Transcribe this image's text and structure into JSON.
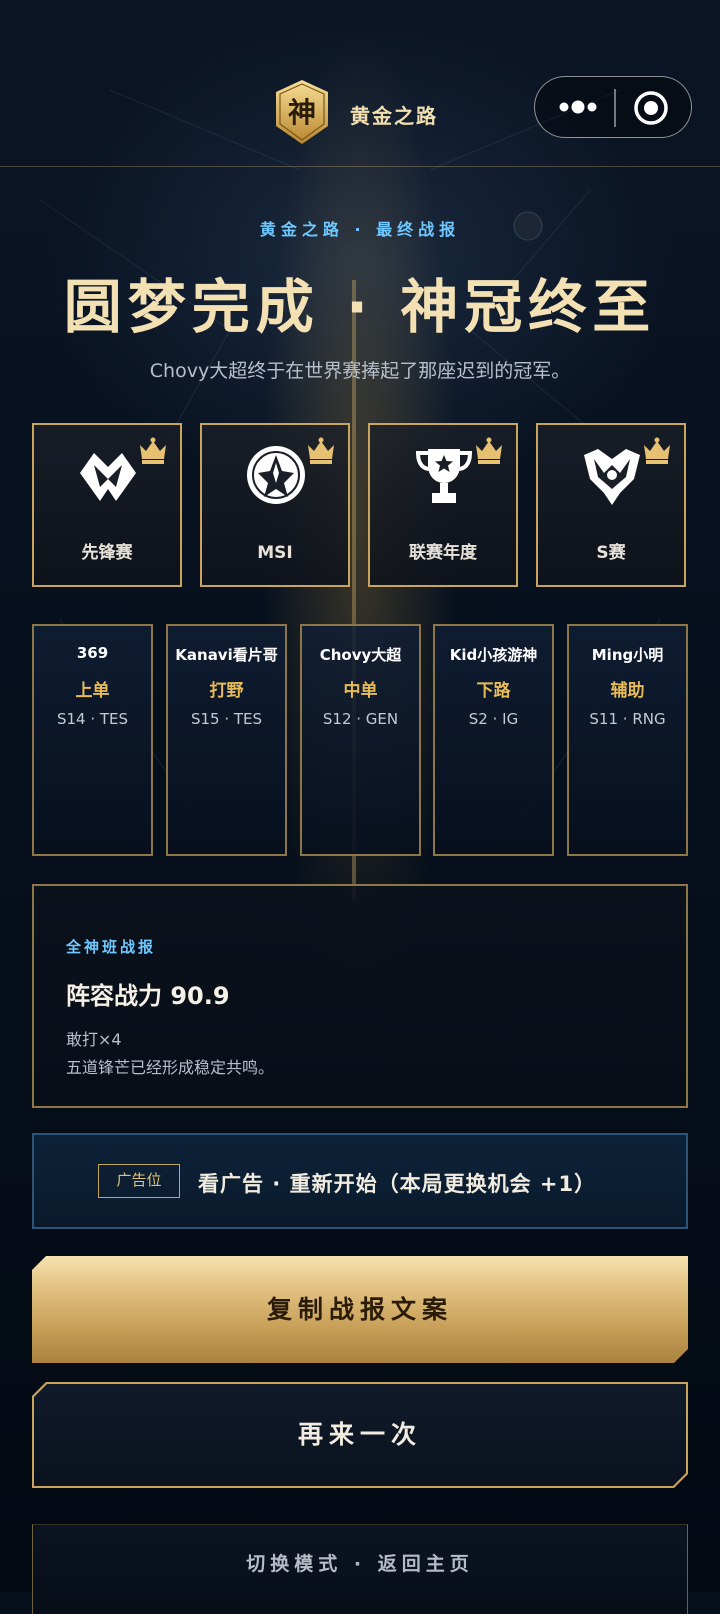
{
  "header": {
    "logo_char": "神",
    "logo_text": "黄金之路",
    "more_icon": "more-dots-icon",
    "close_icon": "target-icon"
  },
  "hero": {
    "kicker": "黄金之路 · 最终战报",
    "title": "圆梦完成 · 神冠终至",
    "subtitle": "Chovy大超终于在世界赛捧起了那座迟到的冠军。"
  },
  "trophies": [
    {
      "label": "先锋赛",
      "icon": "vanguard-emblem-icon"
    },
    {
      "label": "MSI",
      "icon": "msi-emblem-icon"
    },
    {
      "label": "联赛年度",
      "icon": "trophy-cup-icon"
    },
    {
      "label": "S赛",
      "icon": "worlds-emblem-icon"
    }
  ],
  "players": [
    {
      "name": "369",
      "role": "上单",
      "team": "S14 · TES"
    },
    {
      "name": "Kanavi看片哥",
      "role": "打野",
      "team": "S15 · TES"
    },
    {
      "name": "Chovy大超",
      "role": "中单",
      "team": "S12 · GEN"
    },
    {
      "name": "Kid小孩游神",
      "role": "下路",
      "team": "S2 · IG"
    },
    {
      "name": "Ming小明",
      "role": "辅助",
      "team": "S11 · RNG"
    }
  ],
  "report": {
    "label": "全神班战报",
    "score": "阵容战力 90.9",
    "tag": "敢打×4",
    "desc": "五道锋芒已经形成稳定共鸣。"
  },
  "ad": {
    "tag": "广告位",
    "text": "看广告 · 重新开始（本局更换机会 +1）"
  },
  "buttons": {
    "copy": "复制战报文案",
    "again": "再来一次",
    "switch": "切换模式 · 返回主页"
  },
  "colors": {
    "gold": "#c9a45c",
    "accent_blue": "#6ec8ff",
    "role_gold": "#e8bb56"
  }
}
